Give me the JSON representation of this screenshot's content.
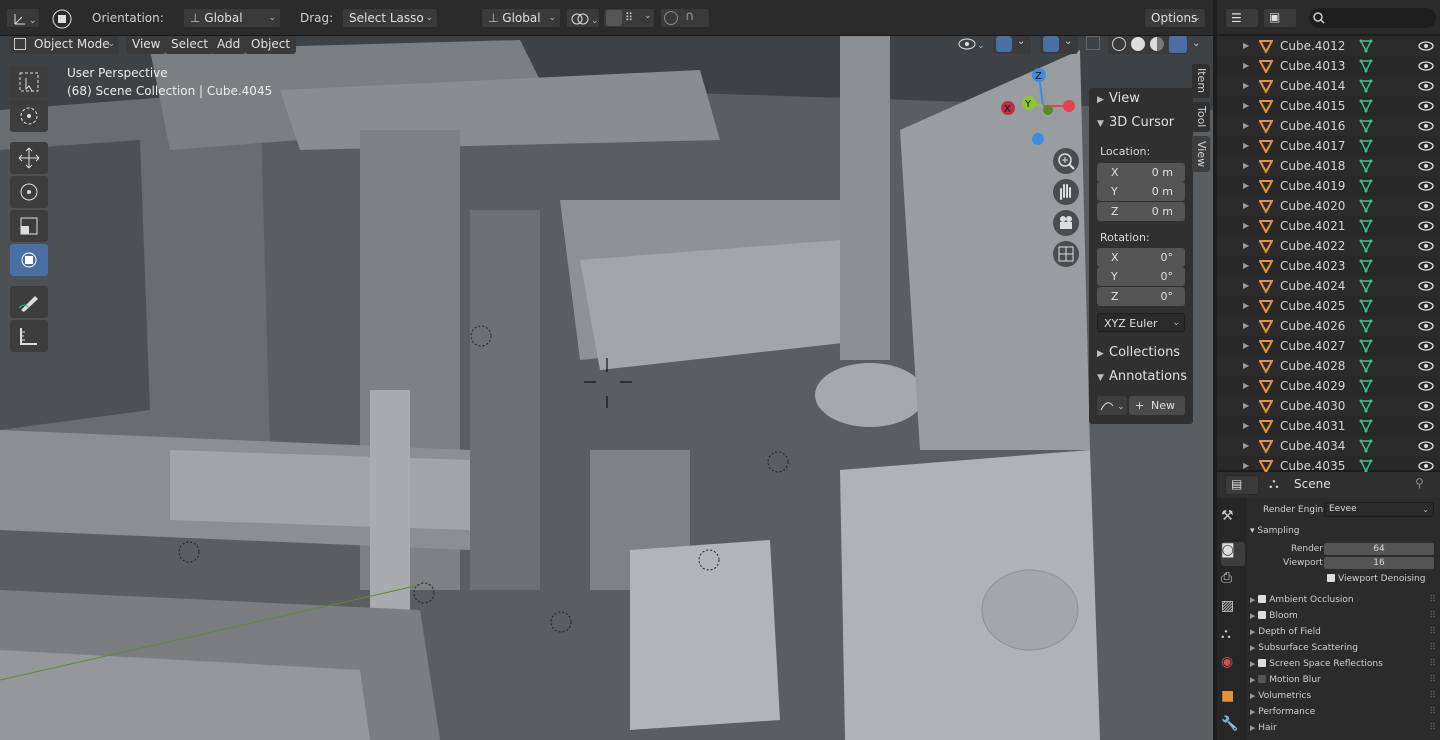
{
  "header": {
    "orientation_label": "Orientation:",
    "orientation_value": "Global",
    "drag_label": "Drag:",
    "drag_value": "Select Lasso",
    "transform_orientation": "Global",
    "options_label": "Options"
  },
  "viewport_menu": {
    "mode": "Object Mode",
    "view": "View",
    "select": "Select",
    "add": "Add",
    "object": "Object"
  },
  "viewport_info": {
    "perspective": "User Perspective",
    "collection": "(68) Scene Collection | Cube.4045"
  },
  "gizmo": {
    "x": "X",
    "y": "Y",
    "z": "Z"
  },
  "npanel": {
    "view_section": "View",
    "cursor_section": "3D Cursor",
    "location_label": "Location:",
    "location": [
      {
        "axis": "X",
        "value": "0 m"
      },
      {
        "axis": "Y",
        "value": "0 m"
      },
      {
        "axis": "Z",
        "value": "0 m"
      }
    ],
    "rotation_label": "Rotation:",
    "rotation": [
      {
        "axis": "X",
        "value": "0°"
      },
      {
        "axis": "Y",
        "value": "0°"
      },
      {
        "axis": "Z",
        "value": "0°"
      }
    ],
    "rotation_mode": "XYZ Euler",
    "collections_section": "Collections",
    "annotations_section": "Annotations",
    "new_button": "New"
  },
  "side_tabs": {
    "item": "Item",
    "tool": "Tool",
    "view": "View"
  },
  "outliner": {
    "items": [
      "Cube.4012",
      "Cube.4013",
      "Cube.4014",
      "Cube.4015",
      "Cube.4016",
      "Cube.4017",
      "Cube.4018",
      "Cube.4019",
      "Cube.4020",
      "Cube.4021",
      "Cube.4022",
      "Cube.4023",
      "Cube.4024",
      "Cube.4025",
      "Cube.4026",
      "Cube.4027",
      "Cube.4028",
      "Cube.4029",
      "Cube.4030",
      "Cube.4031",
      "Cube.4034",
      "Cube.4035"
    ]
  },
  "properties": {
    "context": "Scene",
    "render_engine_label": "Render Engine",
    "render_engine_value": "Eevee",
    "sampling_section": "Sampling",
    "render_label": "Render",
    "render_value": "64",
    "viewport_label": "Viewport",
    "viewport_value": "16",
    "viewport_denoising": "Viewport Denoising",
    "panels": [
      {
        "label": "Ambient Occlusion",
        "checkbox": true,
        "checked": true
      },
      {
        "label": "Bloom",
        "checkbox": true,
        "checked": true
      },
      {
        "label": "Depth of Field",
        "checkbox": false,
        "checked": false
      },
      {
        "label": "Subsurface Scattering",
        "checkbox": false,
        "checked": false
      },
      {
        "label": "Screen Space Reflections",
        "checkbox": true,
        "checked": true
      },
      {
        "label": "Motion Blur",
        "checkbox": true,
        "checked": false
      },
      {
        "label": "Volumetrics",
        "checkbox": false,
        "checked": false
      },
      {
        "label": "Performance",
        "checkbox": false,
        "checked": false
      },
      {
        "label": "Hair",
        "checkbox": false,
        "checked": false
      }
    ]
  },
  "colors": {
    "accent": "#4a6fa5",
    "mesh_icon": "#e8923a",
    "vertex_icon": "#3bbf8a",
    "axis_x": "#e8404f",
    "axis_y": "#8bc832",
    "axis_z": "#3a8de0"
  }
}
